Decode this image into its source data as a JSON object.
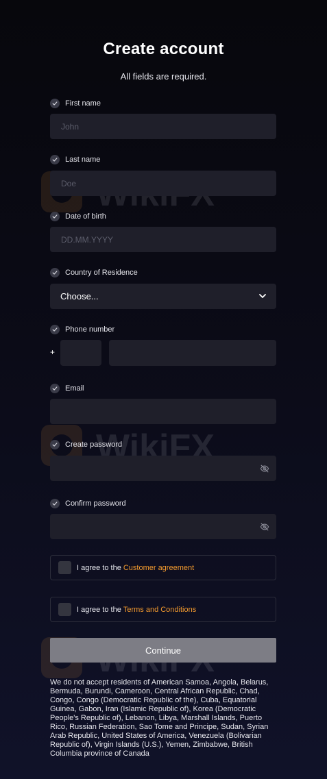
{
  "header": {
    "title": "Create account",
    "subtitle": "All fields are required."
  },
  "fields": {
    "first_name": {
      "label": "First name",
      "placeholder": "John",
      "value": ""
    },
    "last_name": {
      "label": "Last name",
      "placeholder": "Doe",
      "value": ""
    },
    "date_of_birth": {
      "label": "Date of birth",
      "placeholder": "DD.MM.YYYY",
      "value": ""
    },
    "country": {
      "label": "Country of Residence",
      "selected": "Choose..."
    },
    "phone": {
      "label": "Phone number",
      "prefix": "+",
      "code_value": "",
      "number_value": ""
    },
    "email": {
      "label": "Email",
      "value": ""
    },
    "password": {
      "label": "Create password",
      "value": "",
      "toggle_icon": "eye-off-icon"
    },
    "confirm_password": {
      "label": "Confirm password",
      "value": "",
      "toggle_icon": "eye-off-icon"
    }
  },
  "agreements": [
    {
      "text": "I agree to the",
      "link": "Customer agreement"
    },
    {
      "text": "I agree to the",
      "link": "Terms and Conditions"
    }
  ],
  "continue_label": "Continue",
  "notice": "We do not accept residents of American Samoa, Angola, Belarus, Bermuda, Burundi, Cameroon, Central African Republic, Chad, Congo, Congo (Democratic Republic of the), Cuba, Equatorial Guinea, Gabon, Iran (Islamic Republic of), Korea (Democratic People's Republic of), Lebanon, Libya, Marshall Islands, Puerto Rico, Russian Federation, Sao Tome and Principe, Sudan, Syrian Arab Republic, United States of America, Venezuela (Bolivarian Republic of), Virgin Islands (U.S.), Yemen, Zimbabwe, British Columbia province of Canada",
  "colors": {
    "background": "#07070c",
    "field": "#1f1f2a",
    "accent_link": "#f39a2e",
    "button": "#7d7d85"
  }
}
